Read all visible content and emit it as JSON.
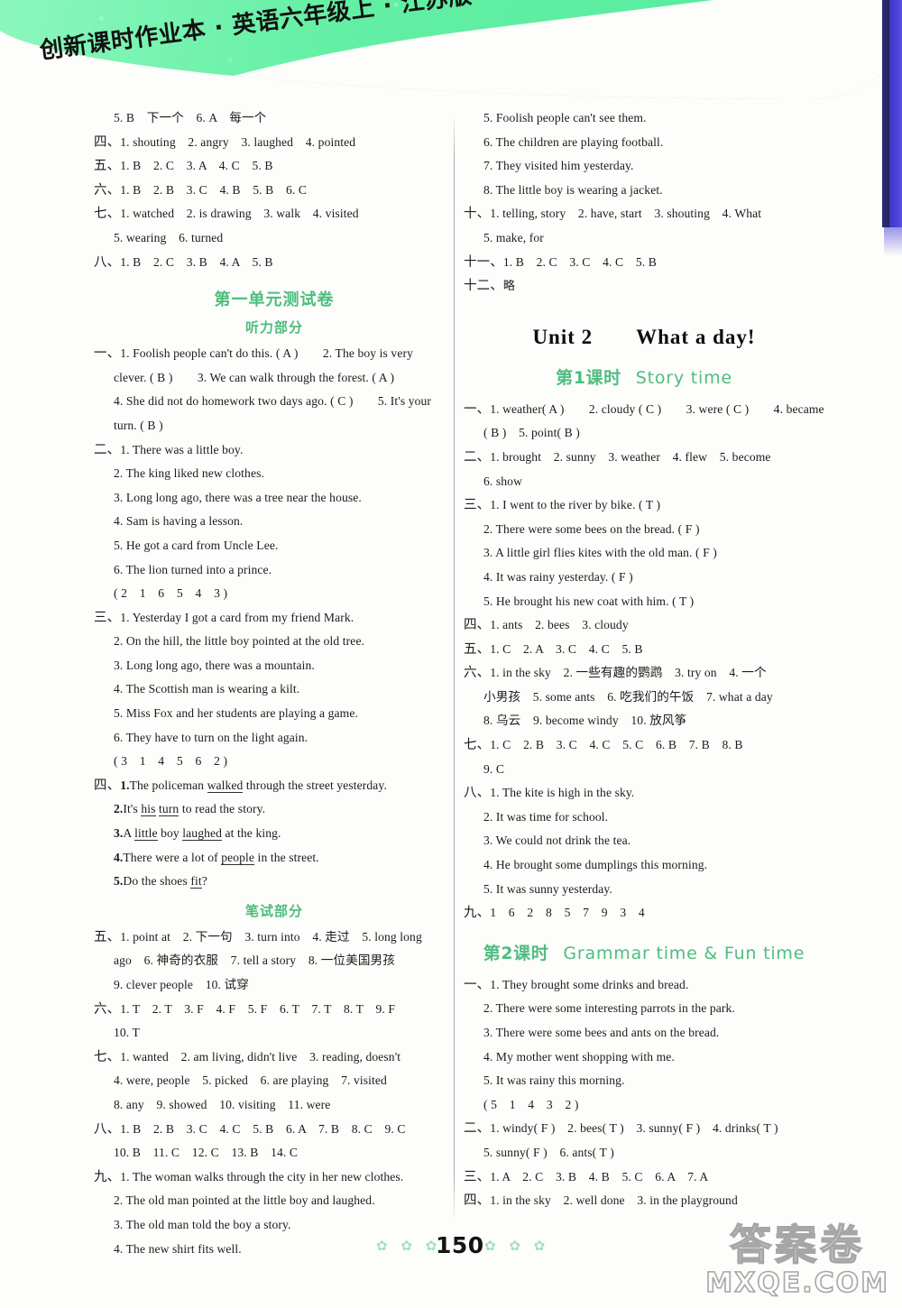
{
  "book": {
    "header_title": "创新课时作业本 · 英语六年级上 · 江苏版",
    "page_number": "150",
    "footer_stars_left": "✿ ✿ ✿",
    "footer_stars_right": "✿ ✿ ✿",
    "watermark_cn": "答案卷",
    "watermark_en": "MXQE.COM"
  },
  "colors": {
    "banner_green": "#63efa4",
    "heading_green": "#4bbd7b",
    "scan_edge_blue": "#4a40d8",
    "text_black": "#1b1b1b"
  },
  "left_column": {
    "carryover": [
      {
        "idx": "",
        "text": "5. B　下一个　6. A　每一个"
      },
      {
        "idx": "四、",
        "text": "1. shouting　2. angry　3. laughed　4. pointed"
      },
      {
        "idx": "五、",
        "text": "1. B　2. C　3. A　4. C　5. B"
      },
      {
        "idx": "六、",
        "text": "1. B　2. B　3. C　4. B　5. B　6. C"
      },
      {
        "idx": "七、",
        "text": "1. watched　2. is drawing　3. walk　4. visited"
      },
      {
        "idx": "",
        "text": "5. wearing　6. turned"
      },
      {
        "idx": "八、",
        "text": "1. B　2. C　3. B　4. A　5. B"
      }
    ],
    "test_heading": "第一单元测试卷",
    "listening_heading": "听力部分",
    "listening": [
      {
        "idx": "一、",
        "lines": [
          "1. Foolish people can't do this. ( A )　　2. The boy is very",
          "clever. ( B )　　3. We can walk through the forest. ( A )",
          "4. She did not do homework two days ago. ( C )　　5. It's your",
          "turn. ( B )"
        ]
      },
      {
        "idx": "二、",
        "lines": [
          "1. There was a little boy.",
          "2. The king liked new clothes.",
          "3. Long long ago, there was a tree near the house.",
          "4. Sam is having a lesson.",
          "5. He got a card from Uncle Lee.",
          "6. The lion turned into a prince.",
          "( 2　1　6　5　4　3 )"
        ]
      },
      {
        "idx": "三、",
        "lines": [
          "1. Yesterday I got a card from my friend Mark.",
          "2. On the hill, the little boy pointed at the old tree.",
          "3. Long long ago, there was a mountain.",
          "4. The Scottish man is wearing a kilt.",
          "5. Miss Fox and her students are playing a game.",
          "6. They have to turn on the light again.",
          "( 3　1　4　5　6　2 )"
        ]
      }
    ],
    "listening_four": {
      "idx": "四、",
      "items": [
        {
          "num": "1.",
          "pre": "The policeman ",
          "u1": "walked",
          "mid": " through the street yesterday.",
          "u2": "",
          "post": ""
        },
        {
          "num": "2.",
          "pre": "It's ",
          "u1": "his",
          "mid": " ",
          "u2": "turn",
          "post": " to read the story."
        },
        {
          "num": "3.",
          "pre": "A ",
          "u1": "little",
          "mid": " boy ",
          "u2": "laughed",
          "post": " at the king."
        },
        {
          "num": "4.",
          "pre": "There were a lot of ",
          "u1": "people",
          "mid": " in the street.",
          "u2": "",
          "post": ""
        },
        {
          "num": "5.",
          "pre": "Do the shoes ",
          "u1": "fit",
          "mid": "?",
          "u2": "",
          "post": ""
        }
      ]
    },
    "written_heading": "笔试部分",
    "written": [
      {
        "idx": "五、",
        "lines": [
          "1. point at　2. 下一句　3. turn into　4. 走过　5. long long",
          "ago　6. 神奇的衣服　7. tell a story　8. 一位美国男孩",
          "9. clever people　10. 试穿"
        ]
      },
      {
        "idx": "六、",
        "lines": [
          "1. T　2. T　3. F　4. F　5. F　6. T　7. T　8. T　9. F",
          "10. T"
        ]
      },
      {
        "idx": "七、",
        "lines": [
          "1. wanted　2. am living, didn't live　3. reading, doesn't",
          "4. were, people　5. picked　6. are playing　7. visited",
          "8. any　9. showed　10. visiting　11. were"
        ]
      },
      {
        "idx": "八、",
        "lines": [
          "1. B　2. B　3. C　4. C　5. B　6. A　7. B　8. C　9. C",
          "10. B　11. C　12. C　13. B　14. C"
        ]
      },
      {
        "idx": "九、",
        "lines": [
          "1. The woman walks through the city in her new clothes.",
          "2. The old man pointed at the little boy and laughed.",
          "3. The old man told the boy a story.",
          "4. The new shirt fits well."
        ]
      }
    ]
  },
  "right_column": {
    "carryover": [
      "5. Foolish people can't see them.",
      "6. The children are playing football.",
      "7. They visited him yesterday.",
      "8. The little boy is wearing a jacket."
    ],
    "sections": [
      {
        "idx": "十、",
        "lines": [
          "1. telling, story　2. have, start　3. shouting　4. What",
          "5. make, for"
        ]
      },
      {
        "idx": "十一、",
        "lines": [
          "1. B　2. C　3. C　4. C　5. B"
        ]
      },
      {
        "idx": "十二、",
        "lines": [
          "略"
        ]
      }
    ],
    "unit_title": "Unit 2　　What a day!",
    "lesson1": {
      "cn": "第1课时",
      "en": "Story time",
      "blocks": [
        {
          "idx": "一、",
          "lines": [
            "1. weather( A )　　2. cloudy ( C )　　3. were ( C )　　4. became",
            "( B )　5. point( B )"
          ]
        },
        {
          "idx": "二、",
          "lines": [
            "1. brought　2. sunny　3. weather　4. flew　5. become",
            "6. show"
          ]
        },
        {
          "idx": "三、",
          "lines": [
            "1. I went to the river by bike. ( T )",
            "2. There were some bees on the bread. ( F )",
            "3. A little girl flies kites with the old man. ( F )",
            "4. It was rainy yesterday. ( F )",
            "5. He brought his new coat with him. ( T )"
          ]
        },
        {
          "idx": "四、",
          "lines": [
            "1. ants　2. bees　3. cloudy"
          ]
        },
        {
          "idx": "五、",
          "lines": [
            "1. C　2. A　3. C　4. C　5. B"
          ]
        },
        {
          "idx": "六、",
          "lines": [
            "1. in the sky　2. 一些有趣的鹦鹉　3. try on　4. 一个",
            "小男孩　5. some ants　6. 吃我们的午饭　7. what a day",
            "8. 乌云　9. become windy　10. 放风筝"
          ]
        },
        {
          "idx": "七、",
          "lines": [
            "1. C　2. B　3. C　4. C　5. C　6. B　7. B　8. B",
            "9. C"
          ]
        },
        {
          "idx": "八、",
          "lines": [
            "1. The kite is high in the sky.",
            "2. It was time for school.",
            "3. We could not drink the tea.",
            "4. He brought some dumplings this morning.",
            "5. It was sunny yesterday."
          ]
        },
        {
          "idx": "九、",
          "lines": [
            "1　6　2　8　5　7　9　3　4"
          ]
        }
      ]
    },
    "lesson2": {
      "cn": "第2课时",
      "en": "Grammar time & Fun time",
      "blocks": [
        {
          "idx": "一、",
          "lines": [
            "1. They brought some drinks and bread.",
            "2. There were some interesting parrots in the park.",
            "3. There were some bees and ants on the bread.",
            "4. My mother went shopping with me.",
            "5. It was rainy this morning.",
            "( 5　1　4　3　2 )"
          ]
        },
        {
          "idx": "二、",
          "lines": [
            "1. windy( F )　2. bees( T )　3. sunny( F )　4. drinks( T )",
            "5. sunny( F )　6. ants( T )"
          ]
        },
        {
          "idx": "三、",
          "lines": [
            "1. A　2. C　3. B　4. B　5. C　6. A　7. A"
          ]
        },
        {
          "idx": "四、",
          "lines": [
            "1. in the sky　2. well done　3. in the playground"
          ]
        }
      ]
    }
  }
}
